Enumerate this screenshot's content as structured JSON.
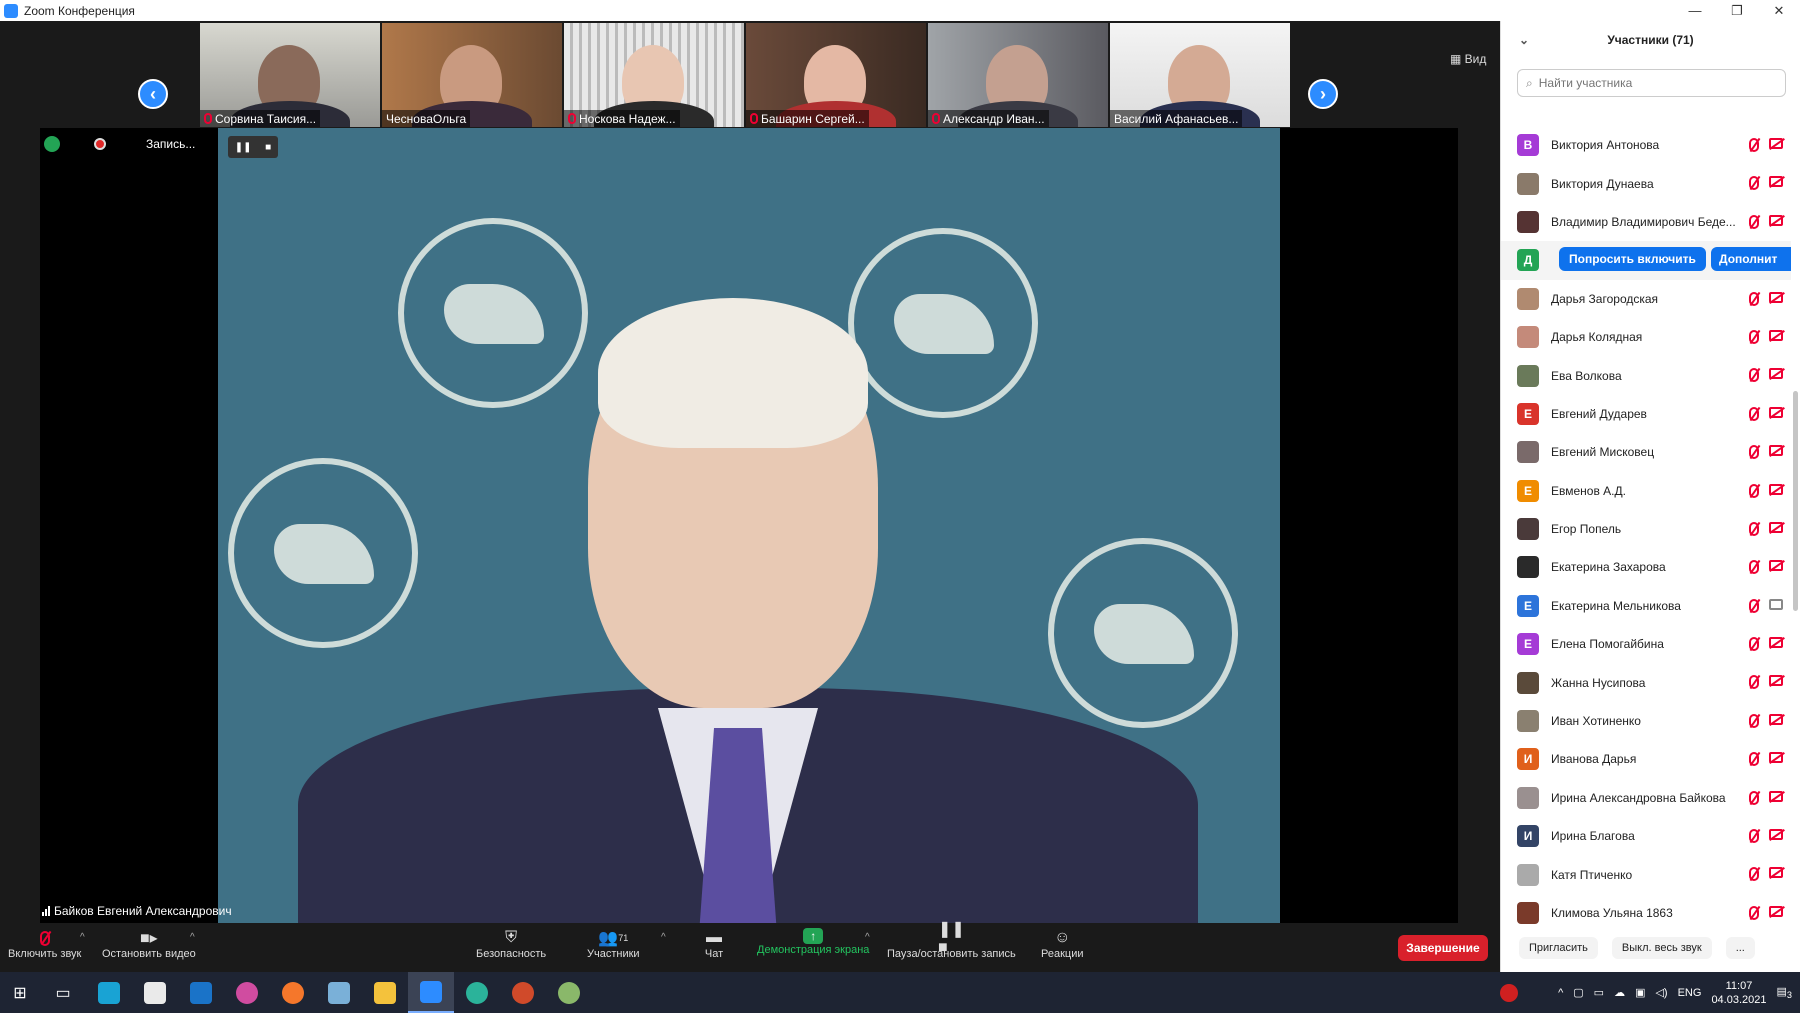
{
  "window": {
    "title": "Zoom Конференция",
    "minimize": "—",
    "restore": "❐",
    "close": "✕"
  },
  "gallery": {
    "view_label": "Вид",
    "prev": "‹",
    "next": "›",
    "thumbnails": [
      {
        "name": "Сорвина Таисия...",
        "muted": true
      },
      {
        "name": "ЧесноваОльга",
        "muted": false
      },
      {
        "name": "Носкова Надеж...",
        "muted": true
      },
      {
        "name": "Башарин Сергей...",
        "muted": true
      },
      {
        "name": "Александр Иван...",
        "muted": true
      },
      {
        "name": "Василий Афанасьев...",
        "muted": false
      }
    ]
  },
  "recording": {
    "label": "Запись...",
    "pause": "❚❚",
    "stop": "■"
  },
  "speaker": {
    "name": "Байков Евгений Александрович"
  },
  "toolbar": {
    "audio": "Включить звук",
    "video": "Остановить видео",
    "security": "Безопасность",
    "participants": "Участники",
    "participants_count": "71",
    "chat": "Чат",
    "share": "Демонстрация экрана",
    "record": "Пауза/остановить запись",
    "reactions": "Реакции",
    "end": "Завершение"
  },
  "panel": {
    "title": "Участники (71)",
    "search_placeholder": "Найти участника",
    "ask_unmute": "Попросить включить",
    "more": "Дополнит",
    "invite": "Пригласить",
    "mute_all": "Выкл. весь звук",
    "more_menu": "...",
    "participants": [
      {
        "name": "Виктория Антонова",
        "initial": "В",
        "color": "#a53bd6",
        "cam": "off"
      },
      {
        "name": "Виктория Дунаева",
        "initial": "",
        "color": "#8a7a6a",
        "cam": "off"
      },
      {
        "name": "Владимир Владимирович Беде...",
        "initial": "",
        "color": "#553333",
        "cam": "off"
      },
      {
        "name": "",
        "initial": "Д",
        "color": "#23a455",
        "cam": "hover"
      },
      {
        "name": "Дарья Загородская",
        "initial": "",
        "color": "#b08a70",
        "cam": "off"
      },
      {
        "name": "Дарья Колядная",
        "initial": "",
        "color": "#c48a7a",
        "cam": "off"
      },
      {
        "name": "Ева Волкова",
        "initial": "",
        "color": "#6a7a5a",
        "cam": "off"
      },
      {
        "name": "Евгений Дударев",
        "initial": "Е",
        "color": "#d9342b",
        "cam": "off"
      },
      {
        "name": "Евгений Мисковец",
        "initial": "",
        "color": "#7a6a6a",
        "cam": "off"
      },
      {
        "name": "Евменов А.Д.",
        "initial": "Е",
        "color": "#f08c00",
        "cam": "off"
      },
      {
        "name": "Егор Попель",
        "initial": "",
        "color": "#4a3a3a",
        "cam": "off"
      },
      {
        "name": "Екатерина Захарова",
        "initial": "",
        "color": "#2a2a2a",
        "cam": "off"
      },
      {
        "name": "Екатерина Мельникова",
        "initial": "Е",
        "color": "#2d74da",
        "cam": "on"
      },
      {
        "name": "Елена Помогайбина",
        "initial": "Е",
        "color": "#a53bd6",
        "cam": "off"
      },
      {
        "name": "Жанна Нусипова",
        "initial": "",
        "color": "#5a4a3a",
        "cam": "off"
      },
      {
        "name": "Иван Хотиненко",
        "initial": "",
        "color": "#8a8070",
        "cam": "off"
      },
      {
        "name": "Иванова Дарья",
        "initial": "И",
        "color": "#e0601b",
        "cam": "off"
      },
      {
        "name": "Ирина Александровна Байкова",
        "initial": "",
        "color": "#9a9090",
        "cam": "off"
      },
      {
        "name": "Ирина Благова",
        "initial": "И",
        "color": "#334466",
        "cam": "off"
      },
      {
        "name": "Катя Птиченко",
        "initial": "",
        "color": "#aaaaaa",
        "cam": "off"
      },
      {
        "name": "Климова Ульяна 1863",
        "initial": "",
        "color": "#7a3a2a",
        "cam": "off"
      }
    ]
  },
  "taskbar": {
    "lang": "ENG",
    "time": "11:07",
    "date": "04.03.2021",
    "notifications": "3"
  }
}
